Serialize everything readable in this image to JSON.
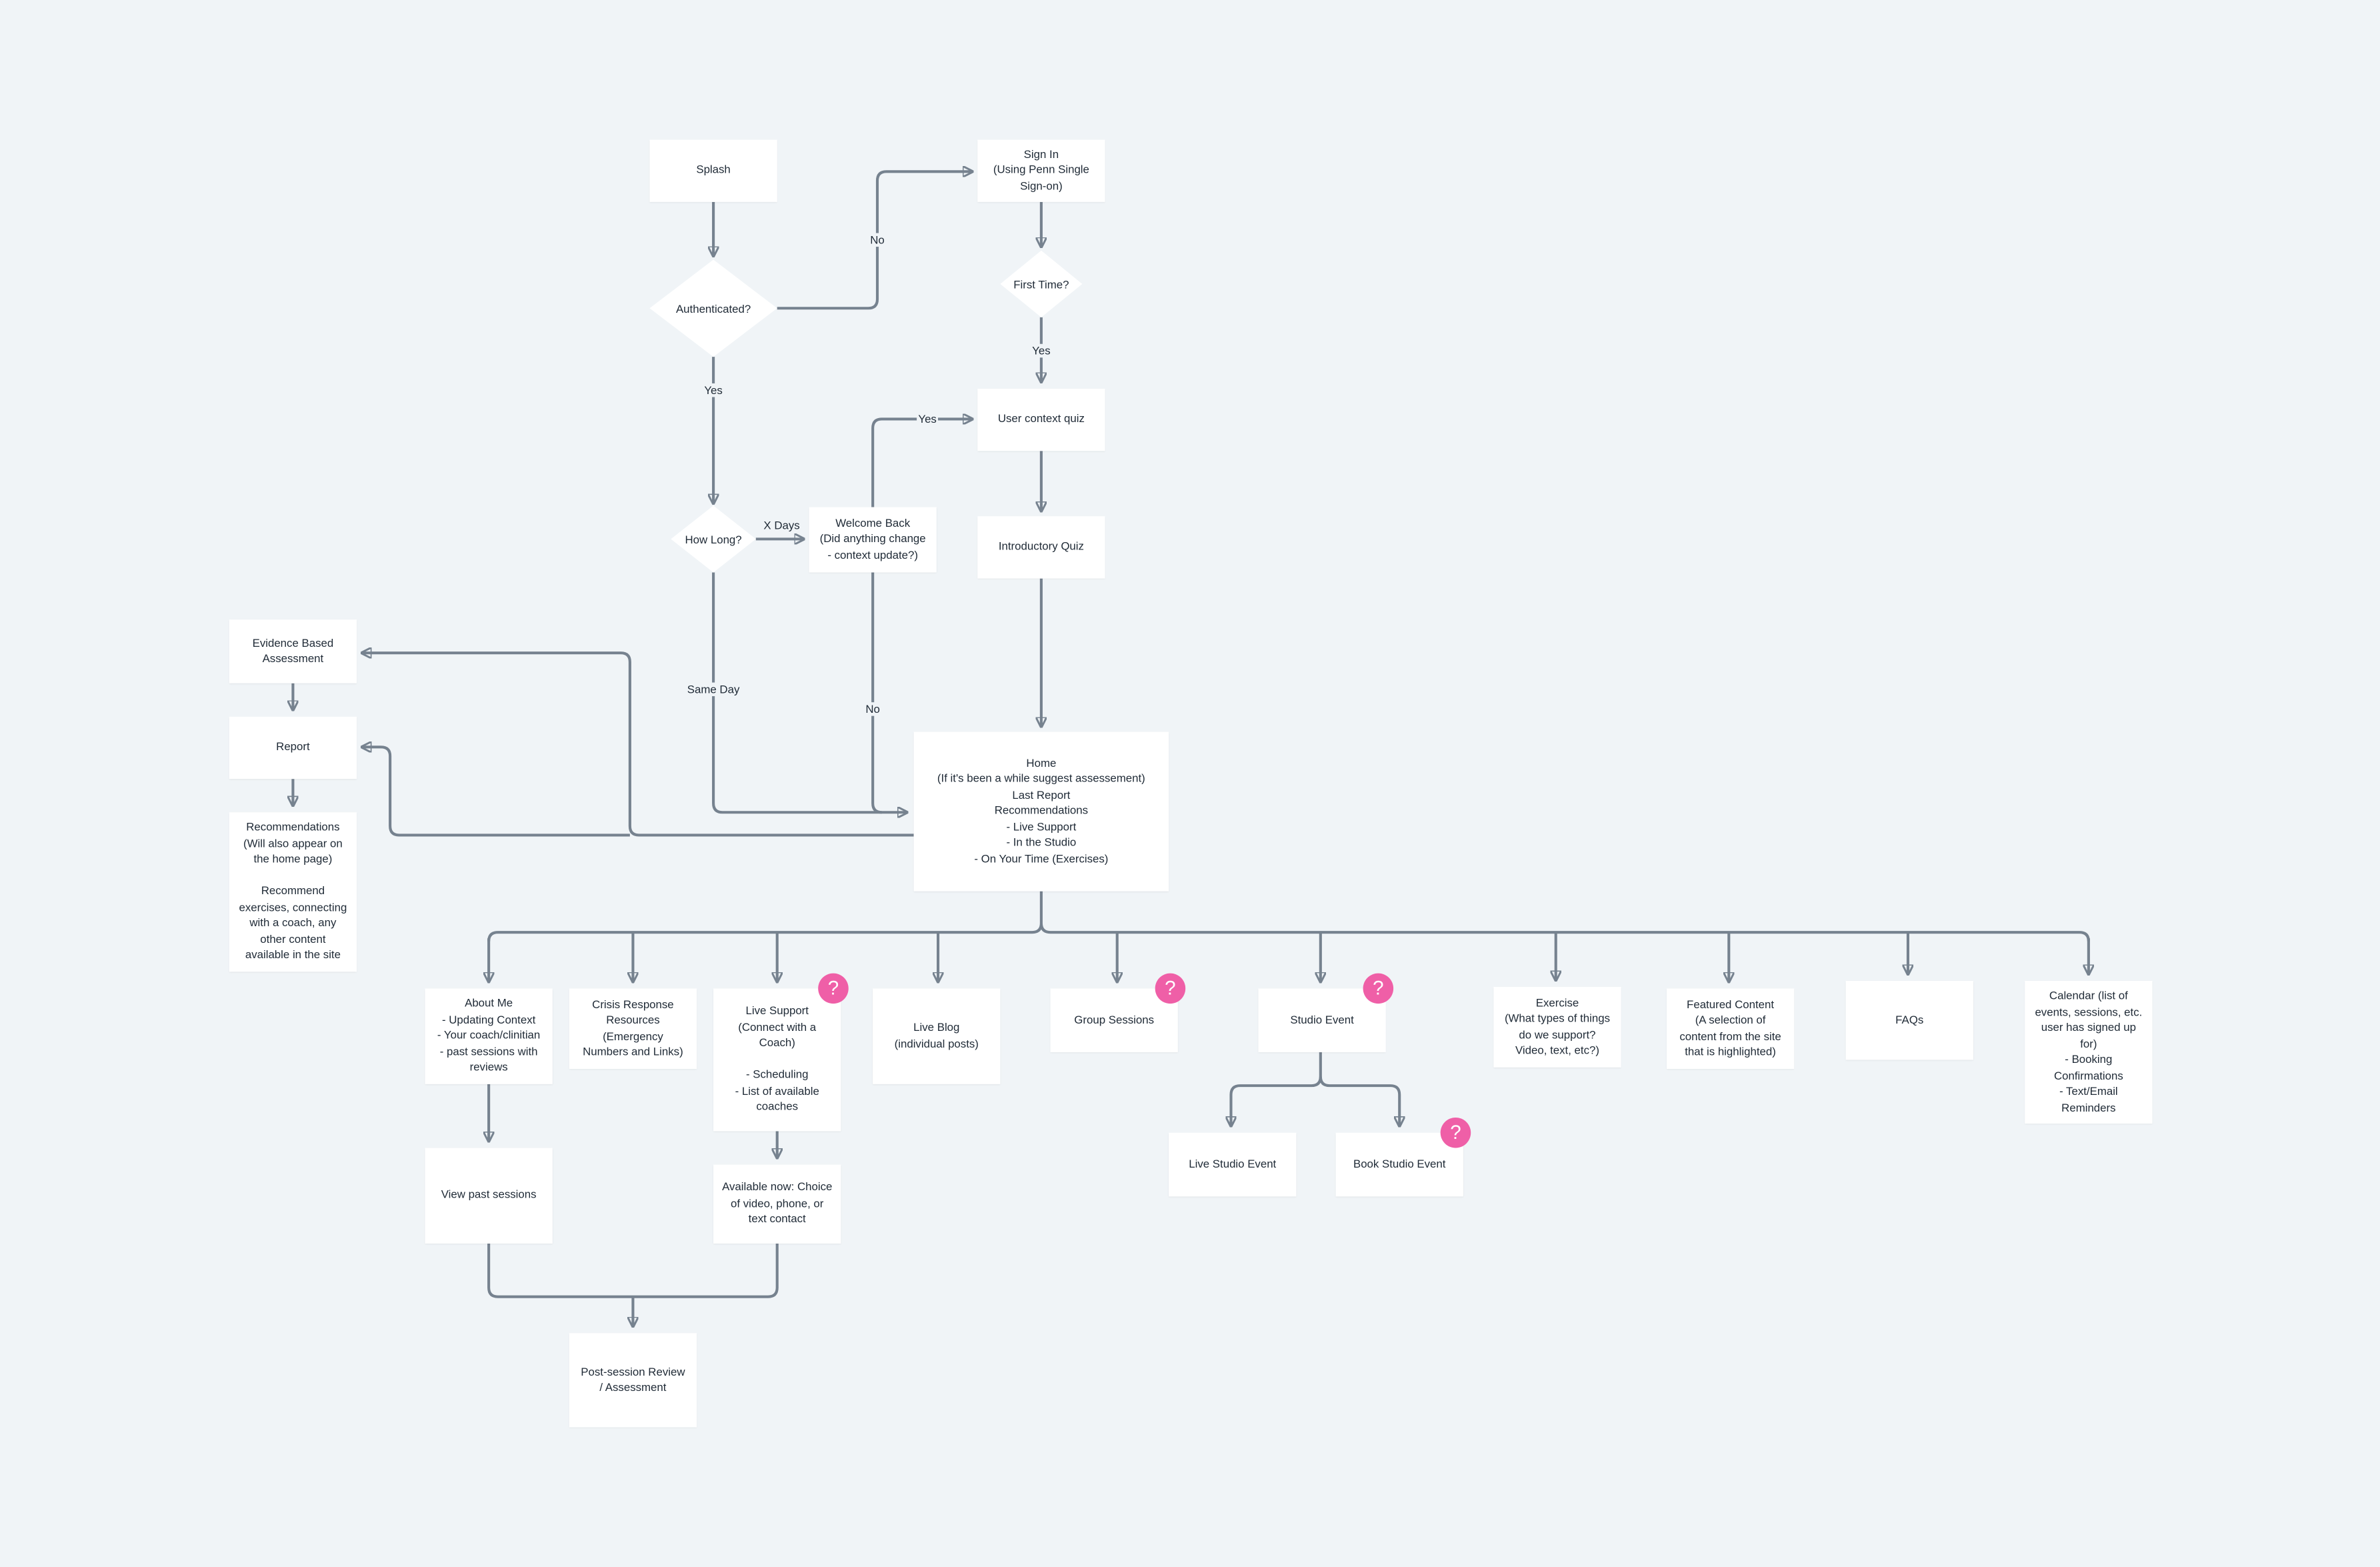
{
  "colors": {
    "background": "#f0f4f7",
    "node": "#ffffff",
    "connector": "#76828f",
    "question_badge": "#ef5fa7",
    "text": "#1f2a36"
  },
  "nodes": [
    {
      "id": "splash",
      "shape": "rect",
      "lines": [
        "Splash"
      ]
    },
    {
      "id": "sign-in",
      "shape": "rect",
      "lines": [
        "Sign In",
        "(Using Penn Single",
        "Sign-on)"
      ]
    },
    {
      "id": "authenticated",
      "shape": "diamond",
      "lines": [
        "Authenticated?"
      ]
    },
    {
      "id": "first-time",
      "shape": "diamond",
      "lines": [
        "First Time?"
      ]
    },
    {
      "id": "user-context-quiz",
      "shape": "rect",
      "lines": [
        "User context quiz"
      ]
    },
    {
      "id": "introductory-quiz",
      "shape": "rect",
      "lines": [
        "Introductory Quiz"
      ]
    },
    {
      "id": "how-long",
      "shape": "diamond",
      "lines": [
        "How Long?"
      ]
    },
    {
      "id": "welcome-back",
      "shape": "rect",
      "lines": [
        "Welcome Back",
        "(Did anything change",
        "- context update?)"
      ]
    },
    {
      "id": "evidence-based-assessment",
      "shape": "rect",
      "lines": [
        "Evidence Based",
        "Assessment"
      ]
    },
    {
      "id": "report",
      "shape": "rect",
      "lines": [
        "Report"
      ]
    },
    {
      "id": "recommendations",
      "shape": "rect",
      "lines": [
        "Recommendations",
        "(Will also appear on",
        "the home page)",
        "",
        "Recommend",
        "exercises, connecting",
        "with a coach, any",
        "other content",
        "available in the site"
      ]
    },
    {
      "id": "home",
      "shape": "rect",
      "lines": [
        "Home",
        "(If it's been a while suggest assessement)",
        "Last Report",
        "Recommendations",
        "- Live Support",
        "- In the Studio",
        "- On Your Time (Exercises)"
      ]
    },
    {
      "id": "about-me",
      "shape": "rect",
      "lines": [
        "About Me",
        "- Updating Context",
        "- Your coach/clinitian",
        "- past sessions with",
        "reviews"
      ]
    },
    {
      "id": "crisis-response",
      "shape": "rect",
      "lines": [
        "Crisis Response",
        "Resources",
        "(Emergency",
        "Numbers and Links)"
      ]
    },
    {
      "id": "live-support",
      "shape": "rect",
      "lines": [
        "Live Support",
        "(Connect with a",
        "Coach)",
        "",
        "- Scheduling",
        "- List of available",
        "coaches"
      ],
      "question": true
    },
    {
      "id": "live-blog",
      "shape": "rect",
      "lines": [
        "Live Blog",
        "(individual posts)"
      ]
    },
    {
      "id": "group-sessions",
      "shape": "rect",
      "lines": [
        "Group Sessions"
      ],
      "question": true
    },
    {
      "id": "studio-event",
      "shape": "rect",
      "lines": [
        "Studio Event"
      ],
      "question": true
    },
    {
      "id": "exercise",
      "shape": "rect",
      "lines": [
        "Exercise",
        "(What types of things",
        "do we support?",
        "Video, text, etc?)"
      ]
    },
    {
      "id": "featured-content",
      "shape": "rect",
      "lines": [
        "Featured Content",
        "(A selection of",
        "content from the site",
        "that is highlighted)"
      ]
    },
    {
      "id": "faqs",
      "shape": "rect",
      "lines": [
        "FAQs"
      ]
    },
    {
      "id": "calendar",
      "shape": "rect",
      "lines": [
        "Calendar (list of",
        "events, sessions, etc.",
        "user has signed up",
        "for)",
        "- Booking",
        "Confirmations",
        "- Text/Email",
        "Reminders"
      ]
    },
    {
      "id": "view-past-sessions",
      "shape": "rect",
      "lines": [
        "View past sessions"
      ]
    },
    {
      "id": "available-now",
      "shape": "rect",
      "lines": [
        "Available now: Choice",
        "of video, phone, or",
        "text contact"
      ]
    },
    {
      "id": "live-studio-event",
      "shape": "rect",
      "lines": [
        "Live Studio Event"
      ]
    },
    {
      "id": "book-studio-event",
      "shape": "rect",
      "lines": [
        "Book Studio Event"
      ],
      "question": true
    },
    {
      "id": "post-session-review",
      "shape": "rect",
      "lines": [
        "Post-session Review",
        "/ Assessment"
      ]
    }
  ],
  "edge_labels": [
    {
      "id": "auth-no",
      "text": "No"
    },
    {
      "id": "first-yes",
      "text": "Yes"
    },
    {
      "id": "auth-yes",
      "text": "Yes"
    },
    {
      "id": "welcome-yes",
      "text": "Yes"
    },
    {
      "id": "howlong-xdays",
      "text": "X Days"
    },
    {
      "id": "howlong-sameday",
      "text": "Same Day"
    },
    {
      "id": "welcome-no",
      "text": "No"
    }
  ],
  "question_badge": {
    "icon": "question-mark-icon",
    "symbol": "?"
  }
}
